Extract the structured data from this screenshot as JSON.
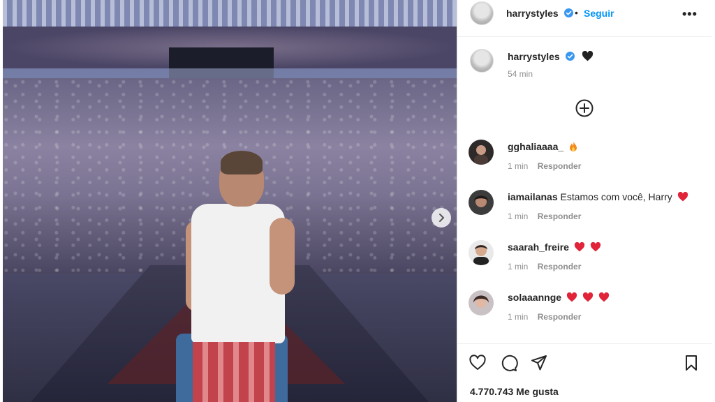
{
  "post": {
    "username": "harrystyles",
    "follow_label": "Seguir",
    "dot": "•",
    "more_label": "•••",
    "caption_time": "54 min",
    "likes": "4.770.743 Me gusta"
  },
  "comments": [
    {
      "user": "gghaliaaaa_",
      "text": "",
      "emoji": "fire-emoji",
      "time": "1 min",
      "reply": "Responder"
    },
    {
      "user": "iamailanas",
      "text": "Estamos com você, Harry",
      "emoji": "red-heart",
      "time": "1 min",
      "reply": "Responder"
    },
    {
      "user": "saarah_freire",
      "text": "",
      "emoji": "red-heart x2",
      "time": "1 min",
      "reply": "Responder"
    },
    {
      "user": "solaaannge",
      "text": "",
      "emoji": "red-heart x3",
      "time": "1 min",
      "reply": "Responder"
    }
  ],
  "colors": {
    "accent": "#0095f6",
    "verified": "#3897f0",
    "muted": "#8e8e8e",
    "heart_red": "#e0243a"
  }
}
